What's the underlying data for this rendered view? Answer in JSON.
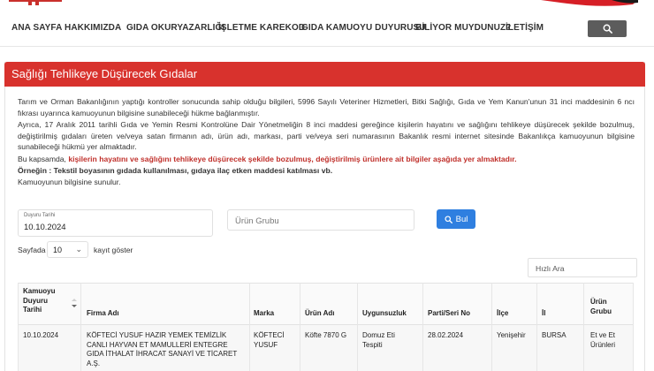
{
  "nav": {
    "items": [
      {
        "label": "ANA SAYFA"
      },
      {
        "label": "HAKKIMIZDA"
      },
      {
        "label": "GIDA OKURYAZARLIĞI"
      },
      {
        "label": "İŞLETME KAREKOD"
      },
      {
        "label": "GIDA KAMUOYU DUYURUSU"
      },
      {
        "label": "BİLİYOR MUYDUNUZ?"
      },
      {
        "label": "İLETİŞİM"
      }
    ],
    "search_icon": "search-icon"
  },
  "panel": {
    "title": "Sağlığı Tehlikeye Düşürecek Gıdalar",
    "para1": "Tarım ve Orman Bakanlığının yaptığı kontroller sonucunda sahip olduğu bilgileri, 5996 Sayılı Veteriner Hizmetleri, Bitki Sağlığı, Gıda ve Yem Kanun'unun 31 inci maddesinin 6 ncı fıkrası uyarınca kamuoyunun bilgisine sunabileceği hükme bağlanmıştır.",
    "para2": "Ayrıca, 17 Aralık 2011 tarihli Gıda ve Yemin Resmi Kontrolüne Dair Yönetmeliğin 8 inci maddesi gereğince kişilerin hayatını ve sağlığını tehlikeye düşürecek şekilde bozulmuş, değiştirilmiş gıdaları üreten ve/veya satan firmanın adı, ürün adı, markası, parti ve/veya seri numarasının Bakanlık resmi internet sitesinde Bakanlıkça kamuoyunun bilgisine sunabileceği hükmü yer almaktadır.",
    "para3_prefix": "Bu kapsamda, ",
    "para3_red": "kişilerin hayatını ve sağlığını tehlikeye düşürecek şekilde bozulmuş, değiştirilmiş ürünlere ait bilgiler aşağıda yer almaktadır.",
    "para4": "Örneğin : Tekstil boyasının gıdada kullanılması, gıdaya ilaç etken maddesi katılması vb.",
    "para5": "Kamuoyunun bilgisine sunulur."
  },
  "filters": {
    "date_label": "Duyuru Tarihi",
    "date_value": "10.10.2024",
    "group_placeholder": "Ürün Grubu",
    "search_button": "Bul",
    "show_prefix": "Sayfada",
    "show_value": "10",
    "show_suffix": "kayıt göster",
    "quick_search_placeholder": "Hızlı Ara"
  },
  "table": {
    "headers": [
      "Kamuoyu Duyuru Tarihi",
      "Firma Adı",
      "Marka",
      "Ürün Adı",
      "Uygunsuzluk",
      "Parti/Seri No",
      "İlçe",
      "İl",
      "Ürün Grubu"
    ],
    "header_lines": {
      "c0": [
        "Kamuoyu",
        "Duyuru",
        "Tarihi"
      ],
      "c8": [
        "Ürün",
        "Grubu"
      ]
    },
    "row": {
      "date": "10.10.2024",
      "firma": [
        "KÖFTECİ YUSUF HAZIR YEMEK TEMİZLİK",
        "CANLI HAYVAN ET MAMULLERİ ENTEGRE",
        "GIDA İTHALAT İHRACAT SANAYİ VE TİCARET",
        "A.Ş."
      ],
      "marka": [
        "KÖFTECİ",
        "YUSUF"
      ],
      "urun": "Köfte 7870 G",
      "uygunsuzluk": [
        "Domuz Eti",
        "Tespiti"
      ],
      "parti": "28.02.2024",
      "ilce": "Yenişehir",
      "il": "BURSA",
      "grup": [
        "Et ve Et",
        "Ürünleri"
      ]
    }
  },
  "colors": {
    "title_bar": "#d8322d",
    "highlight_text": "#c0302b",
    "button_blue": "#2f7fe0",
    "search_button": "#5c5c5c"
  }
}
